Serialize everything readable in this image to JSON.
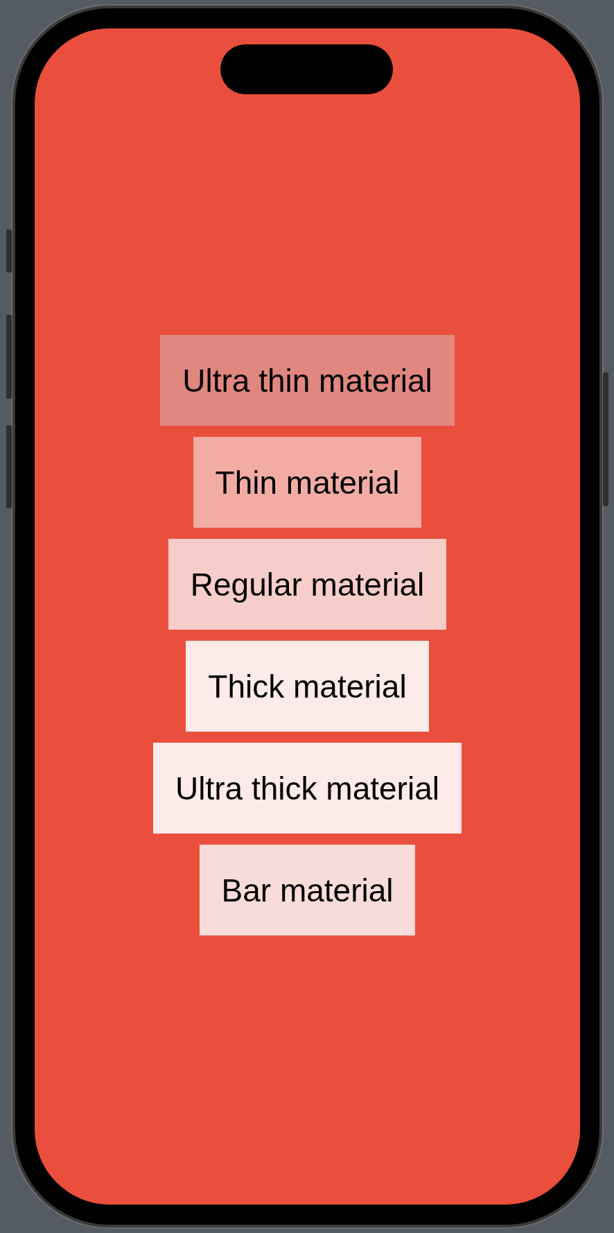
{
  "materials": [
    {
      "label": "Ultra thin material",
      "color": "#e08880"
    },
    {
      "label": "Thin material",
      "color": "#f2aca4"
    },
    {
      "label": "Regular material",
      "color": "#f7cdc9"
    },
    {
      "label": "Thick material",
      "color": "#fcebe8"
    },
    {
      "label": "Ultra thick material",
      "color": "#fcebe8"
    },
    {
      "label": "Bar material",
      "color": "#f7dcd9"
    }
  ]
}
